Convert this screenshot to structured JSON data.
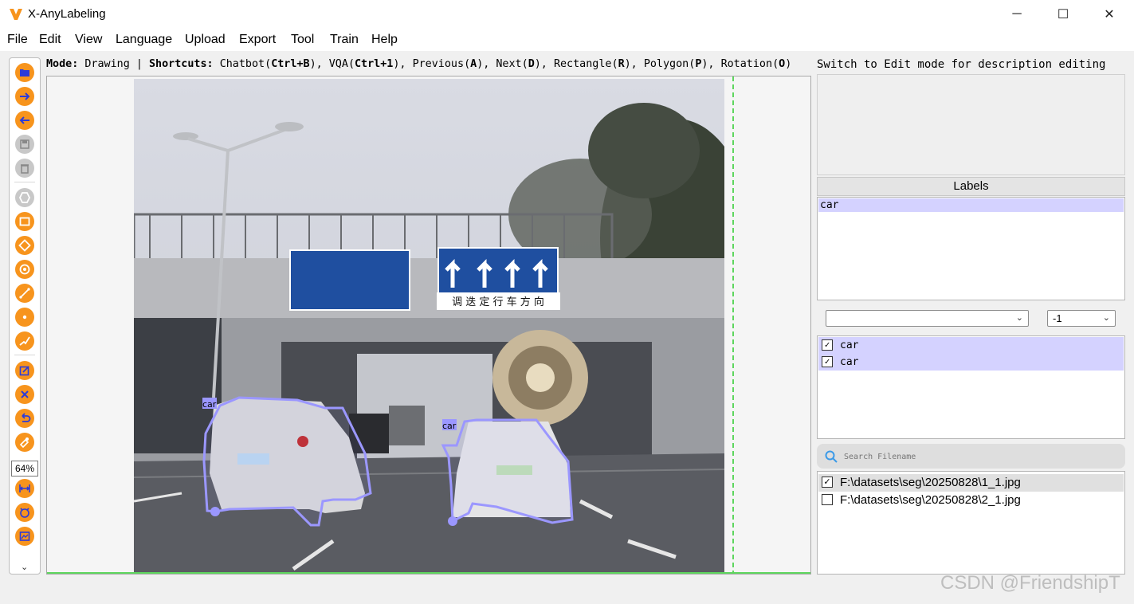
{
  "window": {
    "title": "X-AnyLabeling",
    "controls": {
      "minimize": "─",
      "maximize": "☐",
      "close": "✕"
    }
  },
  "menu": [
    "File",
    "Edit",
    "View",
    "Language",
    "Upload",
    "Export",
    "Tool",
    "Train",
    "Help"
  ],
  "toolbar": {
    "tools": [
      {
        "icon": "open-folder-icon"
      },
      {
        "icon": "next-image-icon"
      },
      {
        "icon": "previous-image-icon"
      },
      {
        "icon": "save-icon"
      },
      {
        "icon": "delete-file-icon"
      },
      {
        "icon": "polygon-icon"
      },
      {
        "icon": "rectangle-icon"
      },
      {
        "icon": "rotation-icon"
      },
      {
        "icon": "circle-icon"
      },
      {
        "icon": "line-icon"
      },
      {
        "icon": "point-icon"
      },
      {
        "icon": "linestrip-icon"
      },
      {
        "icon": "edit-icon"
      },
      {
        "icon": "delete-shape-icon"
      },
      {
        "icon": "undo-icon"
      },
      {
        "icon": "brightness-icon"
      },
      {
        "icon": "fit-width-icon"
      },
      {
        "icon": "fit-window-icon"
      },
      {
        "icon": "ai-icon"
      }
    ],
    "zoom": "64%",
    "more": "⌄"
  },
  "mode_line": {
    "mode_label": "Mode:",
    "mode_value": "Drawing",
    "shortcuts_label": "Shortcuts:",
    "shortcuts": [
      {
        "name": "Chatbot",
        "key": "Ctrl+B"
      },
      {
        "name": "VQA",
        "key": "Ctrl+1"
      },
      {
        "name": "Previous",
        "key": "A"
      },
      {
        "name": "Next",
        "key": "D"
      },
      {
        "name": "Rectangle",
        "key": "R"
      },
      {
        "name": "Polygon",
        "key": "P"
      },
      {
        "name": "Rotation",
        "key": "O"
      }
    ]
  },
  "canvas": {
    "shapes": [
      {
        "label": "car"
      },
      {
        "label": "car"
      }
    ],
    "sign_text": "调 迭 定 行 车 方 向"
  },
  "right_panel": {
    "description_hint": "Switch to Edit mode for description editing",
    "labels_header": "Labels",
    "labels": [
      "car"
    ],
    "group_combo": "",
    "group_id_combo": "-1",
    "shapes": [
      {
        "label": "car",
        "checked": true
      },
      {
        "label": "car",
        "checked": true
      }
    ],
    "search_placeholder": "Search Filename",
    "files": [
      {
        "path": "F:\\datasets\\seg\\20250828\\1_1.jpg",
        "checked": true,
        "selected": true
      },
      {
        "path": "F:\\datasets\\seg\\20250828\\2_1.jpg",
        "checked": false,
        "selected": false
      }
    ]
  },
  "watermark": "CSDN @FriendshipT",
  "colors": {
    "accent_orange": "#f7941d",
    "shape_outline": "#9b97ff",
    "list_highlight": "#d4d2ff"
  }
}
